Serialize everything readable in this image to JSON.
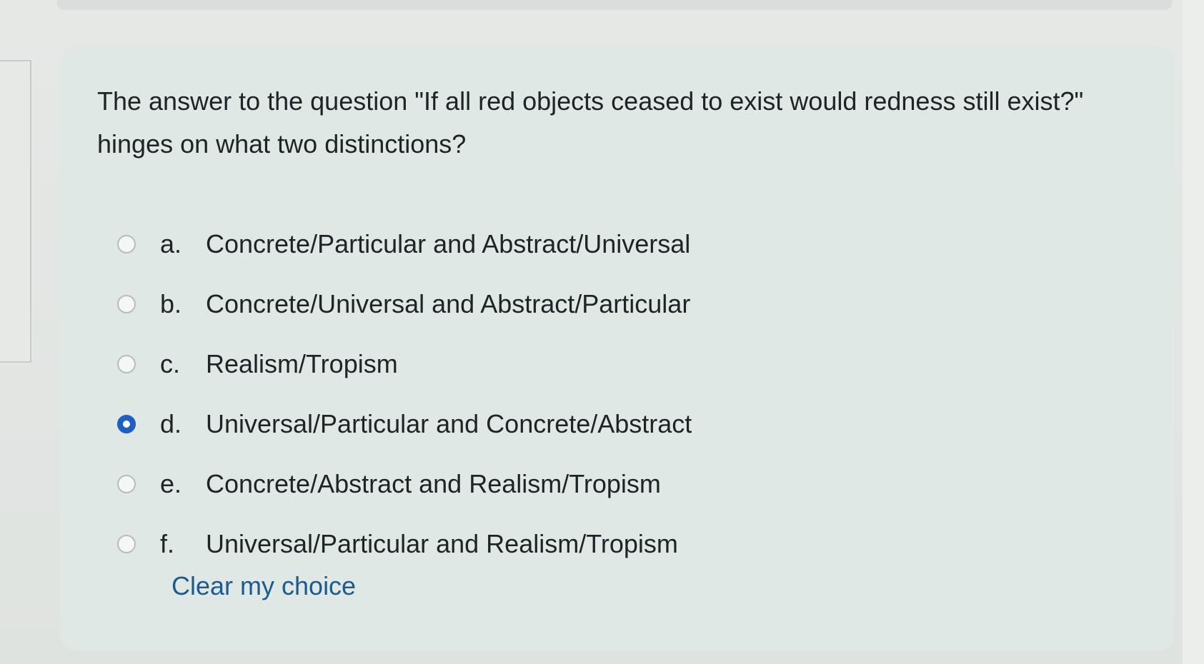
{
  "question": {
    "text": "The answer to the question \"If all red objects ceased to exist would redness still exist?\" hinges on what two distinctions?"
  },
  "options": [
    {
      "letter": "a.",
      "text": "Concrete/Particular and Abstract/Universal",
      "selected": false
    },
    {
      "letter": "b.",
      "text": "Concrete/Universal and Abstract/Particular",
      "selected": false
    },
    {
      "letter": "c.",
      "text": "Realism/Tropism",
      "selected": false
    },
    {
      "letter": "d.",
      "text": "Universal/Particular and Concrete/Abstract",
      "selected": true
    },
    {
      "letter": "e.",
      "text": "Concrete/Abstract and Realism/Tropism",
      "selected": false
    },
    {
      "letter": "f.",
      "text": "Universal/Particular and Realism/Tropism",
      "selected": false
    }
  ],
  "clear_choice": {
    "label": "Clear my choice"
  },
  "colors": {
    "card_background": "#dfe8e4",
    "selected_radio": "#1f5fc4",
    "link": "#1d5b8f",
    "text": "#1e2328"
  }
}
